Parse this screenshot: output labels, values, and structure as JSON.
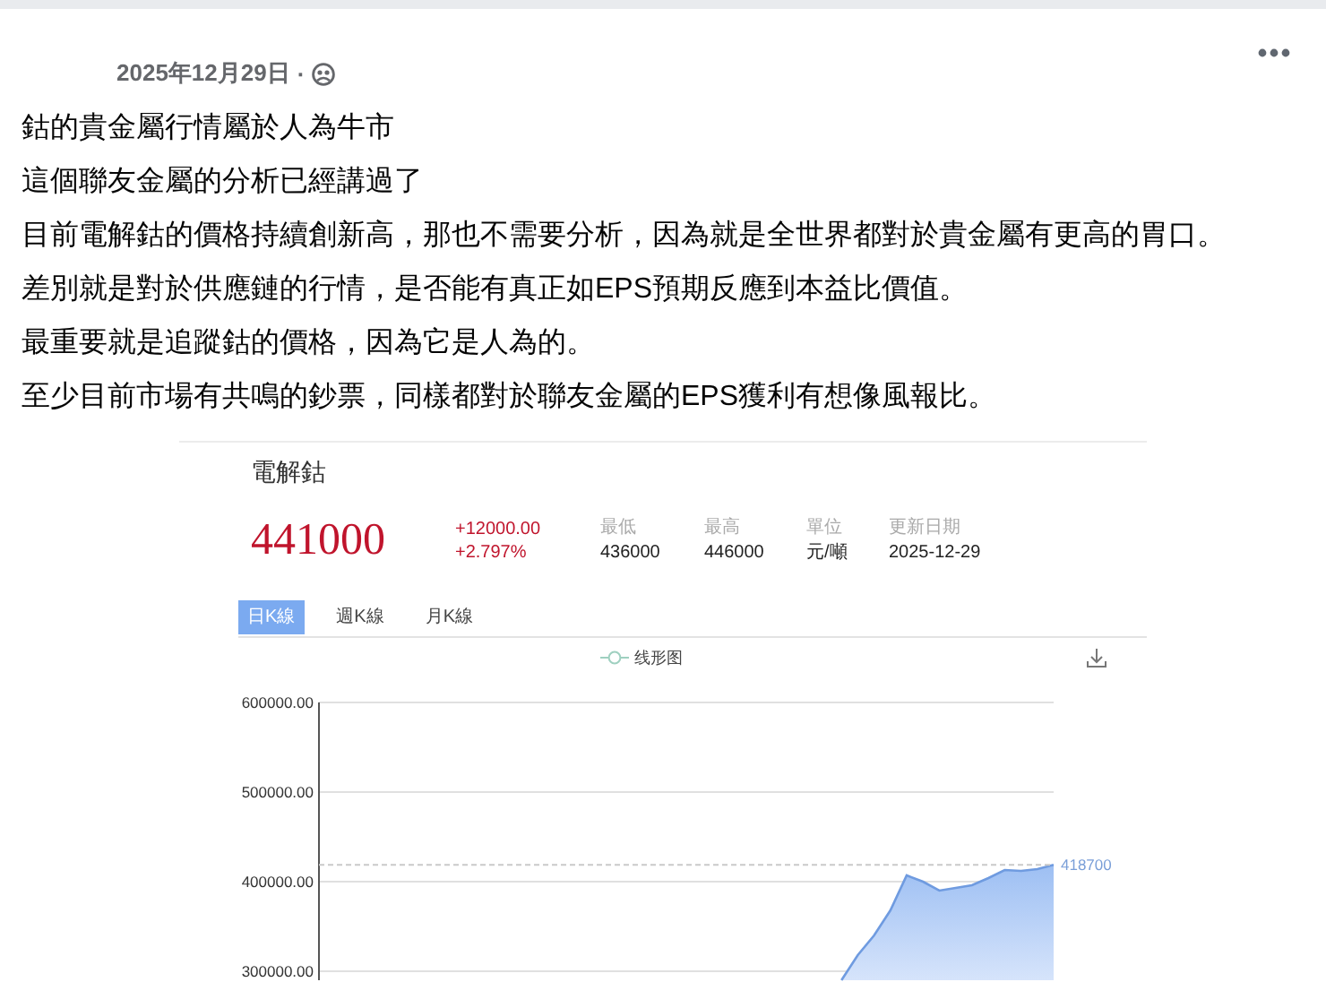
{
  "post": {
    "date": "2025年12月29日",
    "separator": "·",
    "paragraphs": [
      "鈷的貴金屬行情屬於人為牛市",
      "這個聯友金屬的分析已經講過了",
      "目前電解鈷的價格持續創新高，那也不需要分析，因為就是全世界都對於貴金屬有更高的胃口。",
      "差別就是對於供應鏈的行情，是否能有真正如EPS預期反應到本益比價值。",
      "最重要就是追蹤鈷的價格，因為它是人為的。",
      "至少目前市場有共鳴的鈔票，同樣都對於聯友金屬的EPS獲利有想像風報比。"
    ]
  },
  "quote_card": {
    "title": "電解鈷",
    "price": "441000",
    "change": "+12000.00",
    "change_percent": "+2.797%",
    "stats": [
      {
        "label": "最低",
        "value": "436000"
      },
      {
        "label": "最高",
        "value": "446000"
      },
      {
        "label": "單位",
        "value": "元/噸"
      },
      {
        "label": "更新日期",
        "value": "2025-12-29"
      }
    ],
    "tabs": [
      {
        "label": "日K線",
        "selected": true
      },
      {
        "label": "週K線",
        "selected": false
      },
      {
        "label": "月K線",
        "selected": false
      }
    ],
    "chart_data": {
      "type": "area",
      "categories": [
        null,
        null,
        null,
        null,
        null,
        null,
        null,
        null,
        null,
        null,
        null,
        null,
        null,
        null,
        null,
        null,
        null,
        null,
        null,
        null,
        null,
        null,
        null,
        null,
        null,
        null,
        null,
        null,
        null,
        null,
        null,
        null,
        null,
        null,
        null,
        null,
        null,
        null,
        null,
        null,
        null,
        null,
        null,
        null,
        null,
        null
      ],
      "series": [
        {
          "name": "线形图",
          "color": "#6f9be0",
          "values": [
            null,
            null,
            null,
            null,
            null,
            null,
            null,
            null,
            null,
            null,
            null,
            null,
            null,
            null,
            null,
            null,
            null,
            null,
            null,
            null,
            null,
            null,
            null,
            null,
            null,
            null,
            null,
            null,
            null,
            null,
            null,
            null,
            290000,
            318000,
            340000,
            368000,
            407000,
            400000,
            390000,
            393000,
            396000,
            404000,
            413000,
            412000,
            414000,
            418700
          ]
        }
      ],
      "ylim": [
        290000,
        600000
      ],
      "yticks": [
        {
          "value": 300000,
          "label": "300000.00"
        },
        {
          "value": 400000,
          "label": "400000.00"
        },
        {
          "value": 500000,
          "label": "500000.00"
        },
        {
          "value": 600000,
          "label": "600000.00"
        }
      ],
      "grid": true,
      "ref_lines": [
        {
          "axis": "y",
          "value": 418700,
          "label": "418700"
        }
      ]
    }
  }
}
